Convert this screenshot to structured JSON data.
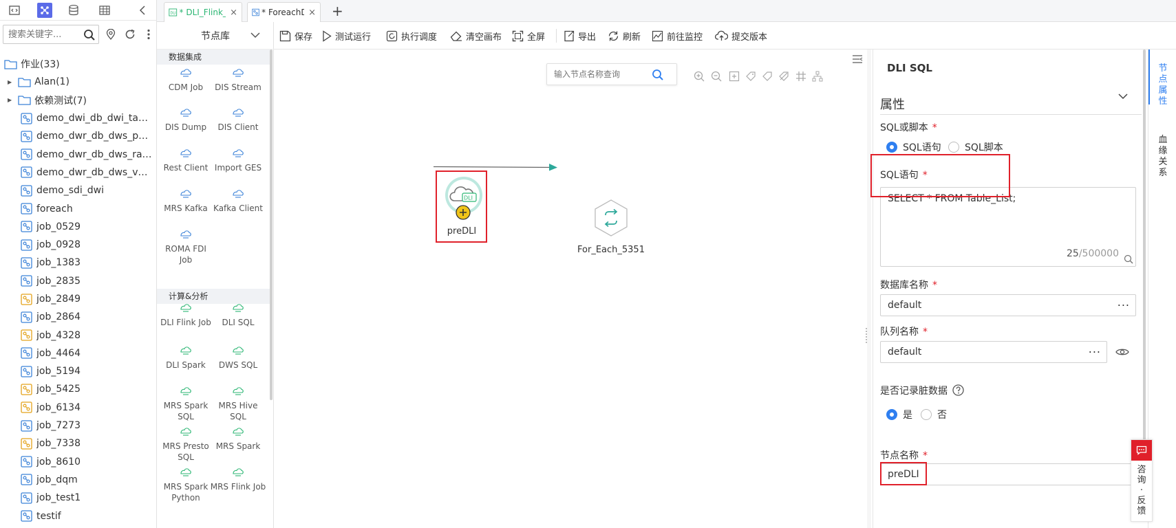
{
  "sidebar": {
    "search_placeholder": "搜索关键字...",
    "root": {
      "label": "作业(33)"
    },
    "folders": [
      {
        "label": "Alan(1)"
      },
      {
        "label": "依赖测试(7)"
      }
    ],
    "jobs": [
      {
        "label": "demo_dwi_db_dwi_taxi_...",
        "color": "#3b82d8"
      },
      {
        "label": "demo_dwr_db_dws_pay...",
        "color": "#3b82d8"
      },
      {
        "label": "demo_dwr_db_dws_rat...",
        "color": "#3b82d8"
      },
      {
        "label": "demo_dwr_db_dws_ven...",
        "color": "#3b82d8"
      },
      {
        "label": "demo_sdi_dwi",
        "color": "#3b82d8"
      },
      {
        "label": "foreach",
        "color": "#3b82d8"
      },
      {
        "label": "job_0529",
        "color": "#3b82d8"
      },
      {
        "label": "job_0928",
        "color": "#3b82d8"
      },
      {
        "label": "job_1383",
        "color": "#3b82d8"
      },
      {
        "label": "job_2835",
        "color": "#3b82d8"
      },
      {
        "label": "job_2849",
        "color": "#e3a21a"
      },
      {
        "label": "job_2864",
        "color": "#3b82d8"
      },
      {
        "label": "job_4328",
        "color": "#e3a21a"
      },
      {
        "label": "job_4464",
        "color": "#3b82d8"
      },
      {
        "label": "job_5194",
        "color": "#3b82d8"
      },
      {
        "label": "job_5425",
        "color": "#e3a21a"
      },
      {
        "label": "job_6134",
        "color": "#e3a21a"
      },
      {
        "label": "job_7273",
        "color": "#3b82d8"
      },
      {
        "label": "job_7338",
        "color": "#e3a21a"
      },
      {
        "label": "job_8610",
        "color": "#3b82d8"
      },
      {
        "label": "job_dqm",
        "color": "#3b82d8"
      },
      {
        "label": "job_test1",
        "color": "#3b82d8"
      },
      {
        "label": "testif",
        "color": "#3b82d8"
      }
    ]
  },
  "tabs": [
    {
      "label": "* DLI_Flink_...",
      "close": "×"
    },
    {
      "label": "* ForeachD...",
      "close": "×"
    }
  ],
  "tabs_add": "+",
  "nodelib": {
    "title": "节点库",
    "categories": [
      {
        "label": "数据集成"
      },
      {
        "label": "计算&分析"
      }
    ],
    "items": [
      "CDM Job",
      "DIS Stream",
      "DIS Dump",
      "DIS Client",
      "Rest Client",
      "Import GES",
      "MRS Kafka",
      "Kafka Client",
      "ROMA FDI Job",
      "DLI Flink Job",
      "DLI SQL",
      "DLI Spark",
      "DWS SQL",
      "MRS Spark SQL",
      "MRS Hive SQL",
      "MRS Presto SQL",
      "MRS Spark",
      "MRS Spark Python",
      "MRS Flink Job"
    ]
  },
  "toolbar": {
    "save": "保存",
    "test_run": "测试运行",
    "schedule": "执行调度",
    "clear": "清空画布",
    "fullscreen": "全屏",
    "export": "导出",
    "refresh": "刷新",
    "monitor": "前往监控",
    "submit": "提交版本"
  },
  "canvas": {
    "search_placeholder": "输入节点名称查询",
    "nodes": [
      {
        "label": "preDLI",
        "badge": "DLI"
      },
      {
        "label": "For_Each_5351"
      }
    ]
  },
  "props": {
    "title": "DLI SQL",
    "section": "属性",
    "sql_or_script_label": "SQL或脚本",
    "sql_option": "SQL语句",
    "script_option": "SQL脚本",
    "sql_label": "SQL语句",
    "sql_value": "SELECT * FROM Table_List;",
    "char_count": "25",
    "char_max": "/500000",
    "db_label": "数据库名称",
    "db_value": "default",
    "queue_label": "队列名称",
    "queue_value": "default",
    "dirty_label": "是否记录脏数据",
    "yes": "是",
    "no": "否",
    "node_name_label": "节点名称",
    "node_name_value": "preDLI",
    "required_mark": "*",
    "more": "···"
  },
  "vtabs": {
    "node_props": "节点属性",
    "lineage": "血缘关系"
  },
  "feedback": {
    "label": "咨询·反馈"
  }
}
